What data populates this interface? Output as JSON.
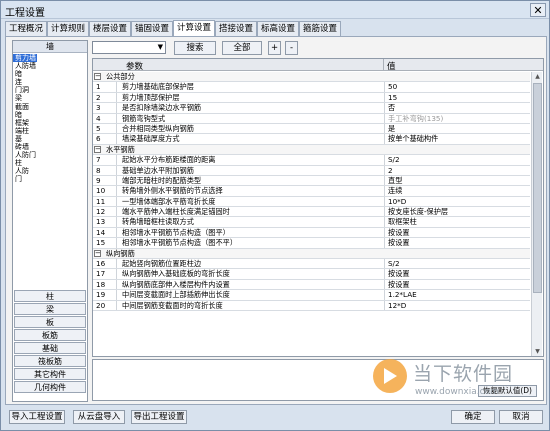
{
  "window": {
    "title": "工程设置",
    "close": "✕"
  },
  "tabs": [
    "工程概况",
    "计算规则",
    "楼层设置",
    "锚固设置",
    "计算设置",
    "搭接设置",
    "标高设置",
    "箍筋设置"
  ],
  "left": {
    "header": "墙",
    "items": [
      "剪力墙",
      "人防墙",
      "暗",
      "连",
      "门洞",
      "梁",
      "截面",
      "暗",
      "框架",
      "端柱",
      "基",
      "砖墙",
      "人防门",
      "柱",
      "人防",
      "门"
    ],
    "buttons": [
      "柱",
      "梁",
      "板",
      "板筋",
      "基础",
      "筏板筋",
      "其它构件",
      "几何构件"
    ]
  },
  "toolbar": {
    "search_label": "搜索",
    "all_label": "全部",
    "plus": "+",
    "minus": "-"
  },
  "grid": {
    "headers": {
      "param": "参数",
      "value": "值"
    },
    "rows": [
      {
        "type": "group",
        "name": "公共部分"
      },
      {
        "num": "1",
        "name": "剪力墙基础底部保护层",
        "value": "50"
      },
      {
        "num": "2",
        "name": "剪力墙顶部保护层",
        "value": "15"
      },
      {
        "num": "3",
        "name": "是否扣除墙梁边水平钢筋",
        "value": "否"
      },
      {
        "num": "4",
        "name": "钢筋弯钩型式",
        "value": "手工补弯钩(135)",
        "gray": true
      },
      {
        "num": "5",
        "name": "合并相同类型纵向钢筋",
        "value": "是"
      },
      {
        "num": "6",
        "name": "墙梁基础厚度方式",
        "value": "按单个基础构件"
      },
      {
        "type": "group",
        "name": "水平钢筋"
      },
      {
        "num": "7",
        "name": "起始水平分布筋距楼面的距离",
        "value": "S/2"
      },
      {
        "num": "8",
        "name": "基础单边水平附加钢筋",
        "value": "2"
      },
      {
        "num": "9",
        "name": "端部无暗柱时的配筋类型",
        "value": "直型"
      },
      {
        "num": "10",
        "name": "转角墙外侧水平钢筋的节点选择",
        "value": "连续"
      },
      {
        "num": "11",
        "name": "一型墙体端部水平筋弯折长度",
        "value": "10*D"
      },
      {
        "num": "12",
        "name": "端水平筋伸入端柱长度满足锚固时",
        "value": "按支座长度-保护层"
      },
      {
        "num": "13",
        "name": "转角墙暗框柱读取方式",
        "value": "取框架柱"
      },
      {
        "num": "14",
        "name": "相邻墙水平钢筋节点构造（图平）",
        "value": "按设置"
      },
      {
        "num": "15",
        "name": "相邻墙水平钢筋节点构造（图不平）",
        "value": "按设置"
      },
      {
        "type": "group",
        "name": "纵向钢筋"
      },
      {
        "num": "16",
        "name": "起始竖向钢筋位置距柱边",
        "value": "S/2"
      },
      {
        "num": "17",
        "name": "纵向钢筋伸入基础底板的弯折长度",
        "value": "按设置"
      },
      {
        "num": "18",
        "name": "纵向钢筋底部伸入楼层构件内设置",
        "value": "按设置"
      },
      {
        "num": "19",
        "name": "中间层变截面时上部插筋伸出长度",
        "value": "1.2*LAE"
      },
      {
        "num": "20",
        "name": "中间层钢筋变截面时的弯折长度",
        "value": "12*D"
      }
    ]
  },
  "restore_label": "恢复默认值(D)",
  "bottom": {
    "import": "导入工程设置",
    "cloud": "从云盘导入",
    "export": "导出工程设置",
    "ok": "确定",
    "cancel": "取消"
  },
  "watermark": {
    "brand": "当下软件园",
    "url": "www.downxia.com"
  }
}
